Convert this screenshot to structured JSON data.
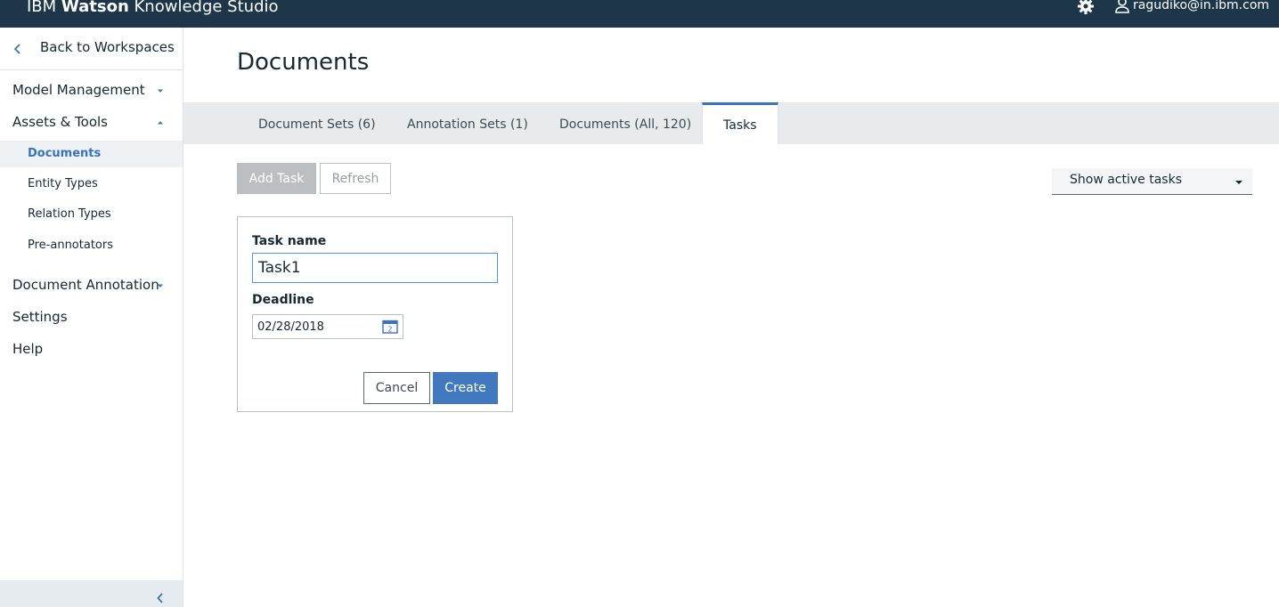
{
  "app": {
    "brand_prefix": "IBM ",
    "brand_strong": "Watson",
    "brand_suffix": " Knowledge Studio",
    "user_email": "ragudiko@in.ibm.com",
    "icons": {
      "settings": "gear-icon",
      "user": "user-icon"
    }
  },
  "sidebar": {
    "back_label": "Back to Workspaces",
    "sections": {
      "model_management": "Model Management",
      "assets_tools": "Assets & Tools",
      "document_annotation": "Document Annotation",
      "settings": "Settings",
      "help": "Help"
    },
    "assets_items": [
      "Documents",
      "Entity Types",
      "Relation Types",
      "Pre-annotators"
    ],
    "active_item": "Documents"
  },
  "main": {
    "title": "Documents",
    "tabs": [
      "Document Sets (6)",
      "Annotation Sets (1)",
      "Documents (All, 120)",
      "Tasks"
    ],
    "active_tab": "Tasks",
    "toolbar": {
      "add_task": "Add Task",
      "refresh": "Refresh"
    },
    "filter": {
      "selected": "Show active tasks"
    },
    "task_form": {
      "task_name_label": "Task name",
      "task_name_value": "Task1",
      "deadline_label": "Deadline",
      "deadline_value": "02/28/2018",
      "calendar_glyph": "2",
      "cancel_label": "Cancel",
      "create_label": "Create"
    }
  },
  "colors": {
    "topbar": "#1d3649",
    "accent": "#3b73b9",
    "primary_button": "#4178be",
    "disabled_button": "#bcbfc2",
    "tabbar": "#e8ebee"
  }
}
